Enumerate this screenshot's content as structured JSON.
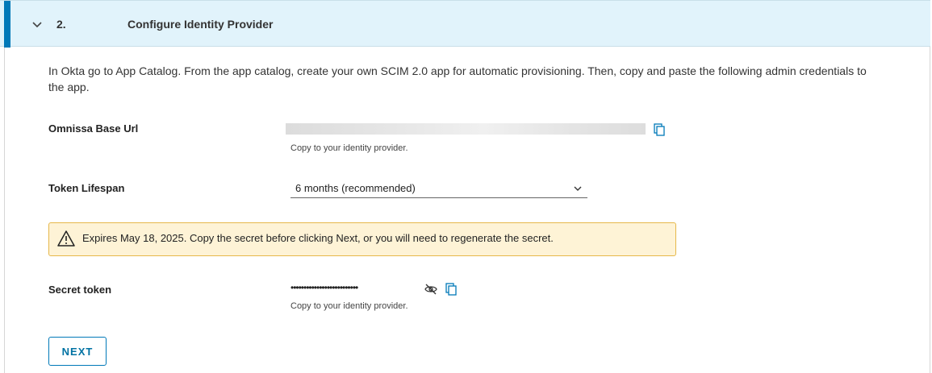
{
  "step": {
    "number": "2.",
    "title": "Configure Identity Provider"
  },
  "intro_text": "In Okta go to App Catalog. From the app catalog, create your own SCIM 2.0 app for automatic provisioning. Then, copy and paste the following admin credentials to the app.",
  "base_url": {
    "label": "Omnissa Base Url",
    "helper": "Copy to your identity provider."
  },
  "token_lifespan": {
    "label": "Token Lifespan",
    "selected": "6 months (recommended)"
  },
  "alert": {
    "text": "Expires May 18, 2025. Copy the secret before clicking Next, or you will need to regenerate the secret."
  },
  "secret_token": {
    "label": "Secret token",
    "masked_value": "••••••••••••••••••••••••••",
    "helper": "Copy to your identity provider."
  },
  "next_button": "NEXT",
  "colors": {
    "accent": "#0079b8",
    "header_bg": "#e1f3fb",
    "warning_bg": "#fef3d6",
    "warning_border": "#e6b84a"
  },
  "icons": [
    "chevron-down-icon",
    "copy-icon",
    "warning-triangle-icon",
    "eye-hide-icon"
  ]
}
